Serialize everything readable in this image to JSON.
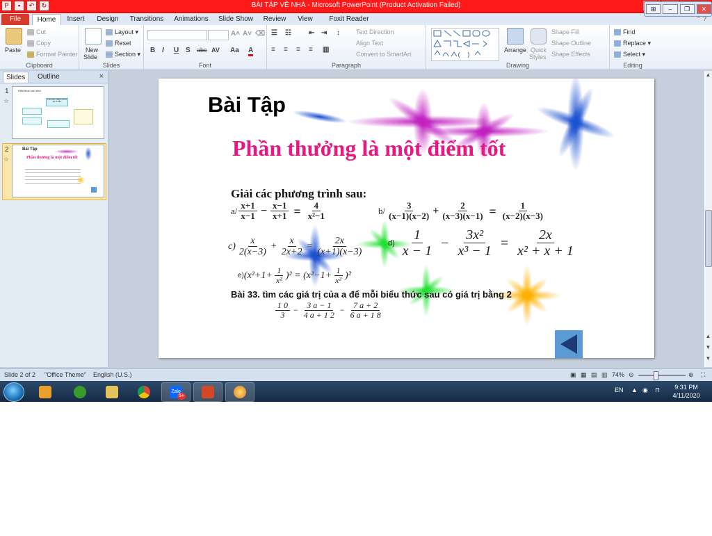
{
  "window": {
    "title": "BÀI TẬP VỀ NHÀ  -  Microsoft PowerPoint (Product Activation Failed)",
    "controls": {
      "minimize": "–",
      "maximize": "□",
      "close": "✕"
    }
  },
  "tabs": [
    "File",
    "Home",
    "Insert",
    "Design",
    "Transitions",
    "Animations",
    "Slide Show",
    "Review",
    "View",
    "Foxit Reader PDF"
  ],
  "ribbon": {
    "clipboard": {
      "paste": "Paste",
      "cut": "Cut",
      "copy": "Copy",
      "format_painter": "Format Painter",
      "label": "Clipboard"
    },
    "slides": {
      "new_slide": "New",
      "new_slide_2": "Slide",
      "layout": "Layout",
      "reset": "Reset",
      "section": "Section",
      "label": "Slides"
    },
    "font": {
      "bold": "B",
      "italic": "I",
      "underline": "U",
      "strike": "S",
      "shadow_abc": "abc",
      "spacing": "AV",
      "case": "Aa",
      "color": "A",
      "label": "Font"
    },
    "paragraph": {
      "text_direction": "Text Direction",
      "align_text": "Align Text",
      "smartart": "Convert to SmartArt",
      "label": "Paragraph"
    },
    "drawing": {
      "arrange": "Arrange",
      "quick_styles": "Quick",
      "quick_styles_2": "Styles",
      "shape_fill": "Shape Fill",
      "shape_outline": "Shape Outline",
      "shape_effects": "Shape Effects",
      "label": "Drawing"
    },
    "editing": {
      "find": "Find",
      "replace": "Replace",
      "select": "Select",
      "label": "Editing"
    }
  },
  "panel": {
    "tab_slides": "Slides",
    "tab_outline": "Outline",
    "close": "×",
    "slide1_num": "1",
    "slide2_num": "2"
  },
  "thumb1": {
    "title": "Kiến thức cần nhớ",
    "center": "PHƯƠNG TRÌNH CHỨA ẨN Ở MẪU"
  },
  "thumb2": {
    "title": "Bài Tập",
    "sub": "Phần thưởng là một điểm tốt"
  },
  "slide": {
    "title": "Bài Tập",
    "subtitle": "Phần thưởng là một điểm tốt",
    "intro": "Giải các phương trình sau:",
    "eq_a": {
      "label": "a/",
      "n1": "x+1",
      "d1": "x−1",
      "op1": "−",
      "n2": "x−1",
      "d2": "x+1",
      "eq": "=",
      "n3": "4",
      "d3": "x²−1"
    },
    "eq_b": {
      "label": "b/",
      "n1": "3",
      "d1": "(x−1)(x−2)",
      "op1": "+",
      "n2": "2",
      "d2": "(x−3)(x−1)",
      "eq": "=",
      "n3": "1",
      "d3": "(x−2)(x−3)"
    },
    "eq_c": {
      "label": "c)",
      "n1": "x",
      "d1": "2(x−3)",
      "op1": "+",
      "n2": "x",
      "d2": "2x+2",
      "eq": "=",
      "n3": "2x",
      "d3": "(x+1)(x−3)"
    },
    "eq_d": {
      "label": "d)",
      "n1": "1",
      "d1": "x − 1",
      "op1": "−",
      "n2": "3x²",
      "d2": "x³ − 1",
      "eq": "=",
      "n3": "2x",
      "d3": "x² + x + 1"
    },
    "eq_e": {
      "label": "e)",
      "left": "(x²+1+",
      "n1": "1",
      "d1": "x²",
      "mid": ")² = (x²−1+",
      "n2": "1",
      "d2": "x²",
      "right": ")²"
    },
    "bai33": "Bài 33. tìm các giá trị của a để mỗi biểu thức sau có giá trị bằng 2",
    "expr": {
      "n1": "1 0",
      "d1": "3",
      "op1": "−",
      "n2": "3 a − 1",
      "d2": "4 a + 1 2",
      "op2": "−",
      "n3": "7 a + 2",
      "d3": "6 a + 1 8"
    }
  },
  "status": {
    "slide": "Slide 2 of 2",
    "theme": "\"Office Theme\"",
    "lang": "English (U.S.)",
    "zoom": "74%"
  },
  "taskbar": {
    "lang": "EN",
    "time": "9:31 PM",
    "date": "4/11/2020",
    "zalo": "Zalo",
    "zalo_badge": "5+"
  },
  "colors": {
    "titlebar": "#ff1a1a",
    "subtitle": "#e5197f",
    "back_button": "#5b9bd5"
  }
}
